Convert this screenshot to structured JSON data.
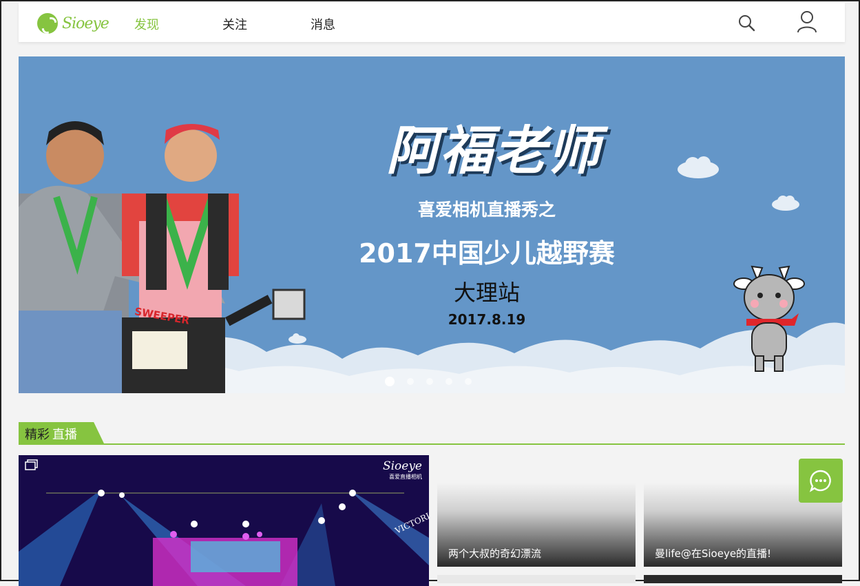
{
  "brand": {
    "logo_text": "Sioeye",
    "accent": "#86c440"
  },
  "nav": {
    "tabs": [
      {
        "label": "发现"
      },
      {
        "label": "关注"
      },
      {
        "label": "消息"
      }
    ]
  },
  "banner": {
    "title": "阿福老师",
    "subtitle": "喜爱相机直播秀之",
    "race": "2017中国少儿越野赛",
    "stop": "大理站",
    "date": "2017.8.19",
    "bib_text": "SWEEPER",
    "slide_count": 5,
    "active_slide": 1
  },
  "live_section": {
    "tag_prefix": "精彩",
    "tag_main": "直播"
  },
  "cards": {
    "main": {
      "watermark": "Sioeye",
      "watermark_sub": "喜爱直播相机",
      "sign": "VICTORI"
    },
    "small": [
      {
        "caption": "两个大叔的奇幻漂流"
      },
      {
        "caption": "曼life@在Sioeye的直播!"
      }
    ]
  }
}
